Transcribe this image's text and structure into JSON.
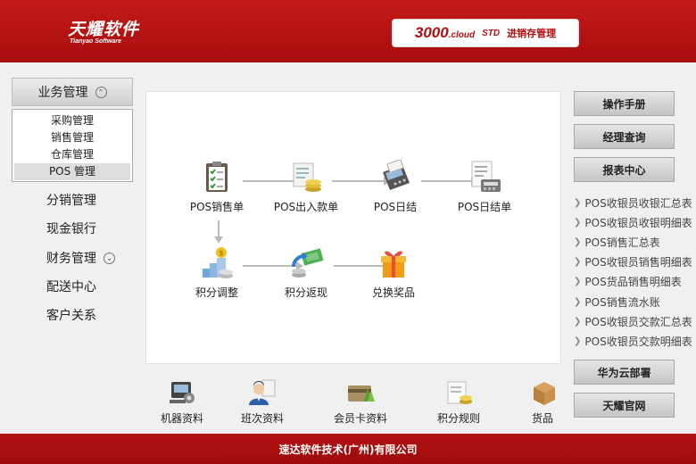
{
  "header": {
    "logo_cn": "天耀软件",
    "logo_en": "Tianyao Software",
    "product_version": "3000",
    "product_cloud": ".cloud",
    "product_edition": "STD",
    "product_name": "进销存管理"
  },
  "left_nav": {
    "expanded_label": "业务管理",
    "sub_items": [
      "采购管理",
      "销售管理",
      "仓库管理",
      "POS 管理"
    ],
    "active_sub": "POS 管理",
    "items": [
      {
        "label": "分销管理",
        "has_chevron": false
      },
      {
        "label": "现金银行",
        "has_chevron": false
      },
      {
        "label": "财务管理",
        "has_chevron": true
      },
      {
        "label": "配送中心",
        "has_chevron": false
      },
      {
        "label": "客户关系",
        "has_chevron": false
      }
    ]
  },
  "flow": {
    "nodes": [
      {
        "label": "POS销售单",
        "icon": "clipboard-icon"
      },
      {
        "label": "POS出入款单",
        "icon": "coins-icon"
      },
      {
        "label": "POS日结",
        "icon": "card-terminal-icon"
      },
      {
        "label": "POS日结单",
        "icon": "report-icon"
      },
      {
        "label": "积分调整",
        "icon": "stairs-icon"
      },
      {
        "label": "积分返现",
        "icon": "cashback-icon"
      },
      {
        "label": "兑换奖品",
        "icon": "gift-icon"
      }
    ]
  },
  "toolbar": {
    "items": [
      {
        "label": "机器资料",
        "icon": "machine-icon"
      },
      {
        "label": "班次资料",
        "icon": "person-icon"
      },
      {
        "label": "会员卡资料",
        "icon": "card-icon"
      },
      {
        "label": "积分规则",
        "icon": "document-icon"
      },
      {
        "label": "货品",
        "icon": "box-icon"
      }
    ]
  },
  "right_panel": {
    "buttons_top": [
      "操作手册",
      "经理查询",
      "报表中心"
    ],
    "report_links": [
      "POS收银员收银汇总表",
      "POS收银员收银明细表",
      "POS销售汇总表",
      "POS收银员销售明细表",
      "POS货品销售明细表",
      "POS销售流水账",
      "POS收银员交款汇总表",
      "POS收银员交款明细表"
    ],
    "buttons_bottom": [
      "华为云部署",
      "天耀官网"
    ]
  },
  "footer": {
    "text": "速达软件技术(广州)有限公司"
  },
  "colors": {
    "brand_red": "#b30f0f",
    "panel_bg": "#ffffff",
    "page_bg": "#f0f0f0"
  }
}
